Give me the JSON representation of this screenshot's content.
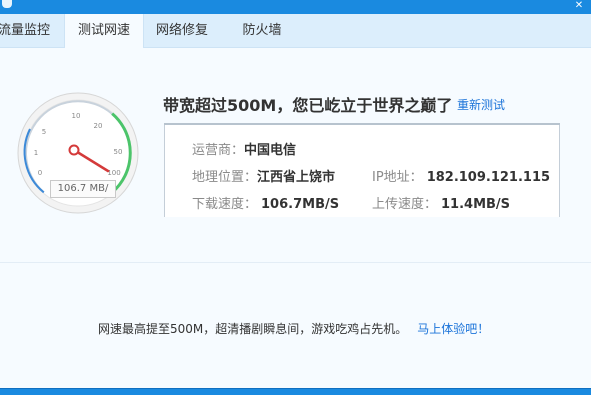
{
  "colors": {
    "titlebar": "#1a8ae0",
    "link": "#1a73d9",
    "needle": "#d43a3a"
  },
  "tabs": [
    {
      "label": "流量监控"
    },
    {
      "label": "测试网速"
    },
    {
      "label": "网络修复"
    },
    {
      "label": "防火墙"
    }
  ],
  "active_tab": "测试网速",
  "gauge": {
    "ticks": [
      "0",
      "1",
      "5",
      "10",
      "20",
      "50",
      "100"
    ],
    "speed_value": 106.7,
    "speed_label": "106.7 MB/"
  },
  "result": {
    "headline": "带宽超过500M，您已屹立于世界之巅了",
    "retest_label": "重新测试",
    "isp_label": "运营商：",
    "isp_value": "中国电信",
    "location_label": "地理位置：",
    "location_value": "江西省上饶市",
    "ip_label": "IP地址：",
    "ip_value": "182.109.121.115",
    "download_label": "下载速度：",
    "download_value": "106.7MB/S",
    "upload_label": "上传速度：",
    "upload_value": "11.4MB/S"
  },
  "promo": {
    "text": "网速最高提至500M，超清播剧瞬息间，游戏吃鸡占先机。",
    "link": "马上体验吧！"
  }
}
